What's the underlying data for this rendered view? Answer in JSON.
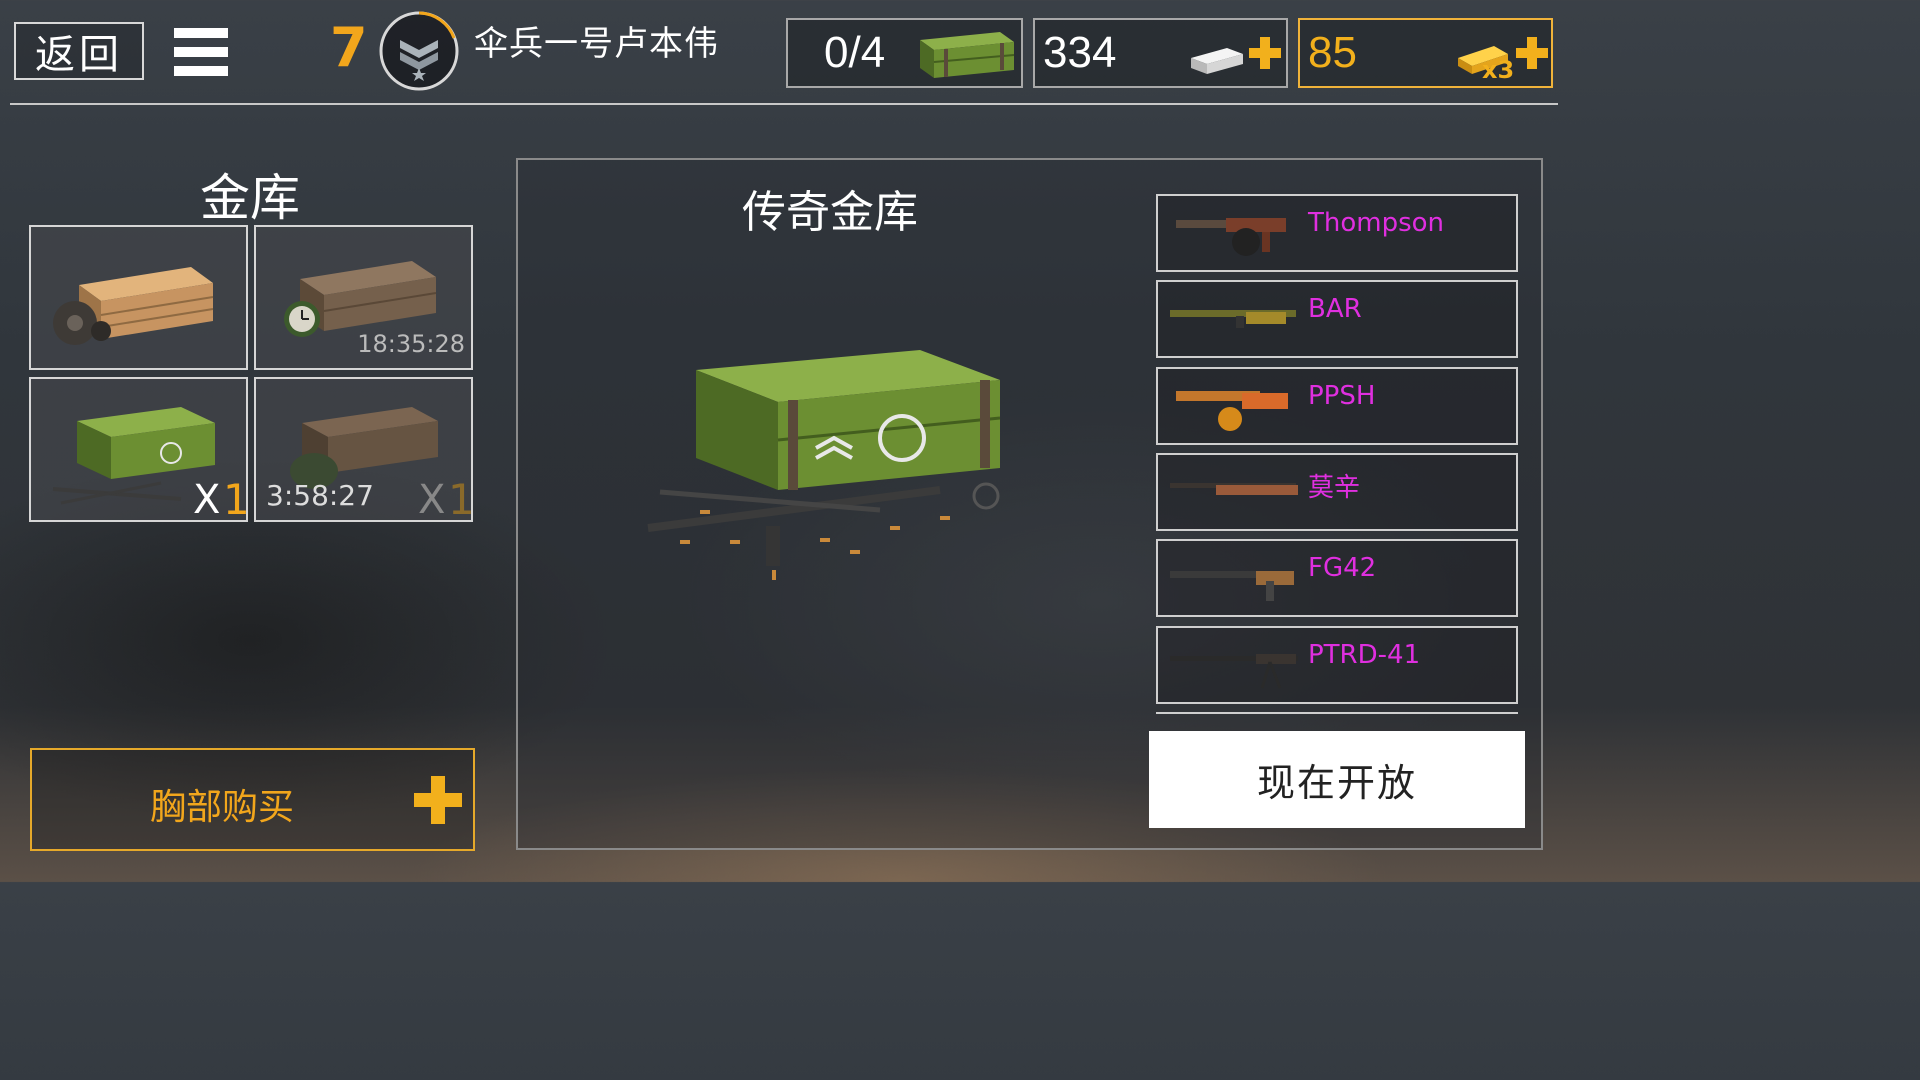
{
  "header": {
    "back_label": "返回",
    "level": "7",
    "player_name": "伞兵一号卢本伟",
    "crates": "0/4",
    "silver": "334",
    "gold": "85",
    "gold_bonus": "x3"
  },
  "vault": {
    "title": "金库",
    "tiles": [
      {
        "timer": "",
        "count_x": "",
        "count_n": ""
      },
      {
        "timer": "18:35:28",
        "count_x": "",
        "count_n": ""
      },
      {
        "timer": "",
        "count_x": "X",
        "count_n": "1"
      },
      {
        "timer": "3:58:27",
        "count_x": "X",
        "count_n": "1"
      }
    ],
    "buy_label": "胸部购买"
  },
  "legendary": {
    "title": "传奇金库",
    "weapons": [
      "Thompson",
      "BAR",
      "PPSH",
      "莫辛",
      "FG42",
      "PTRD-41"
    ],
    "open_label": "现在开放"
  },
  "colors": {
    "accent_gold": "#f2a61c",
    "weapon_name": "#e02fe0",
    "crate_green": "#6c8f32"
  }
}
